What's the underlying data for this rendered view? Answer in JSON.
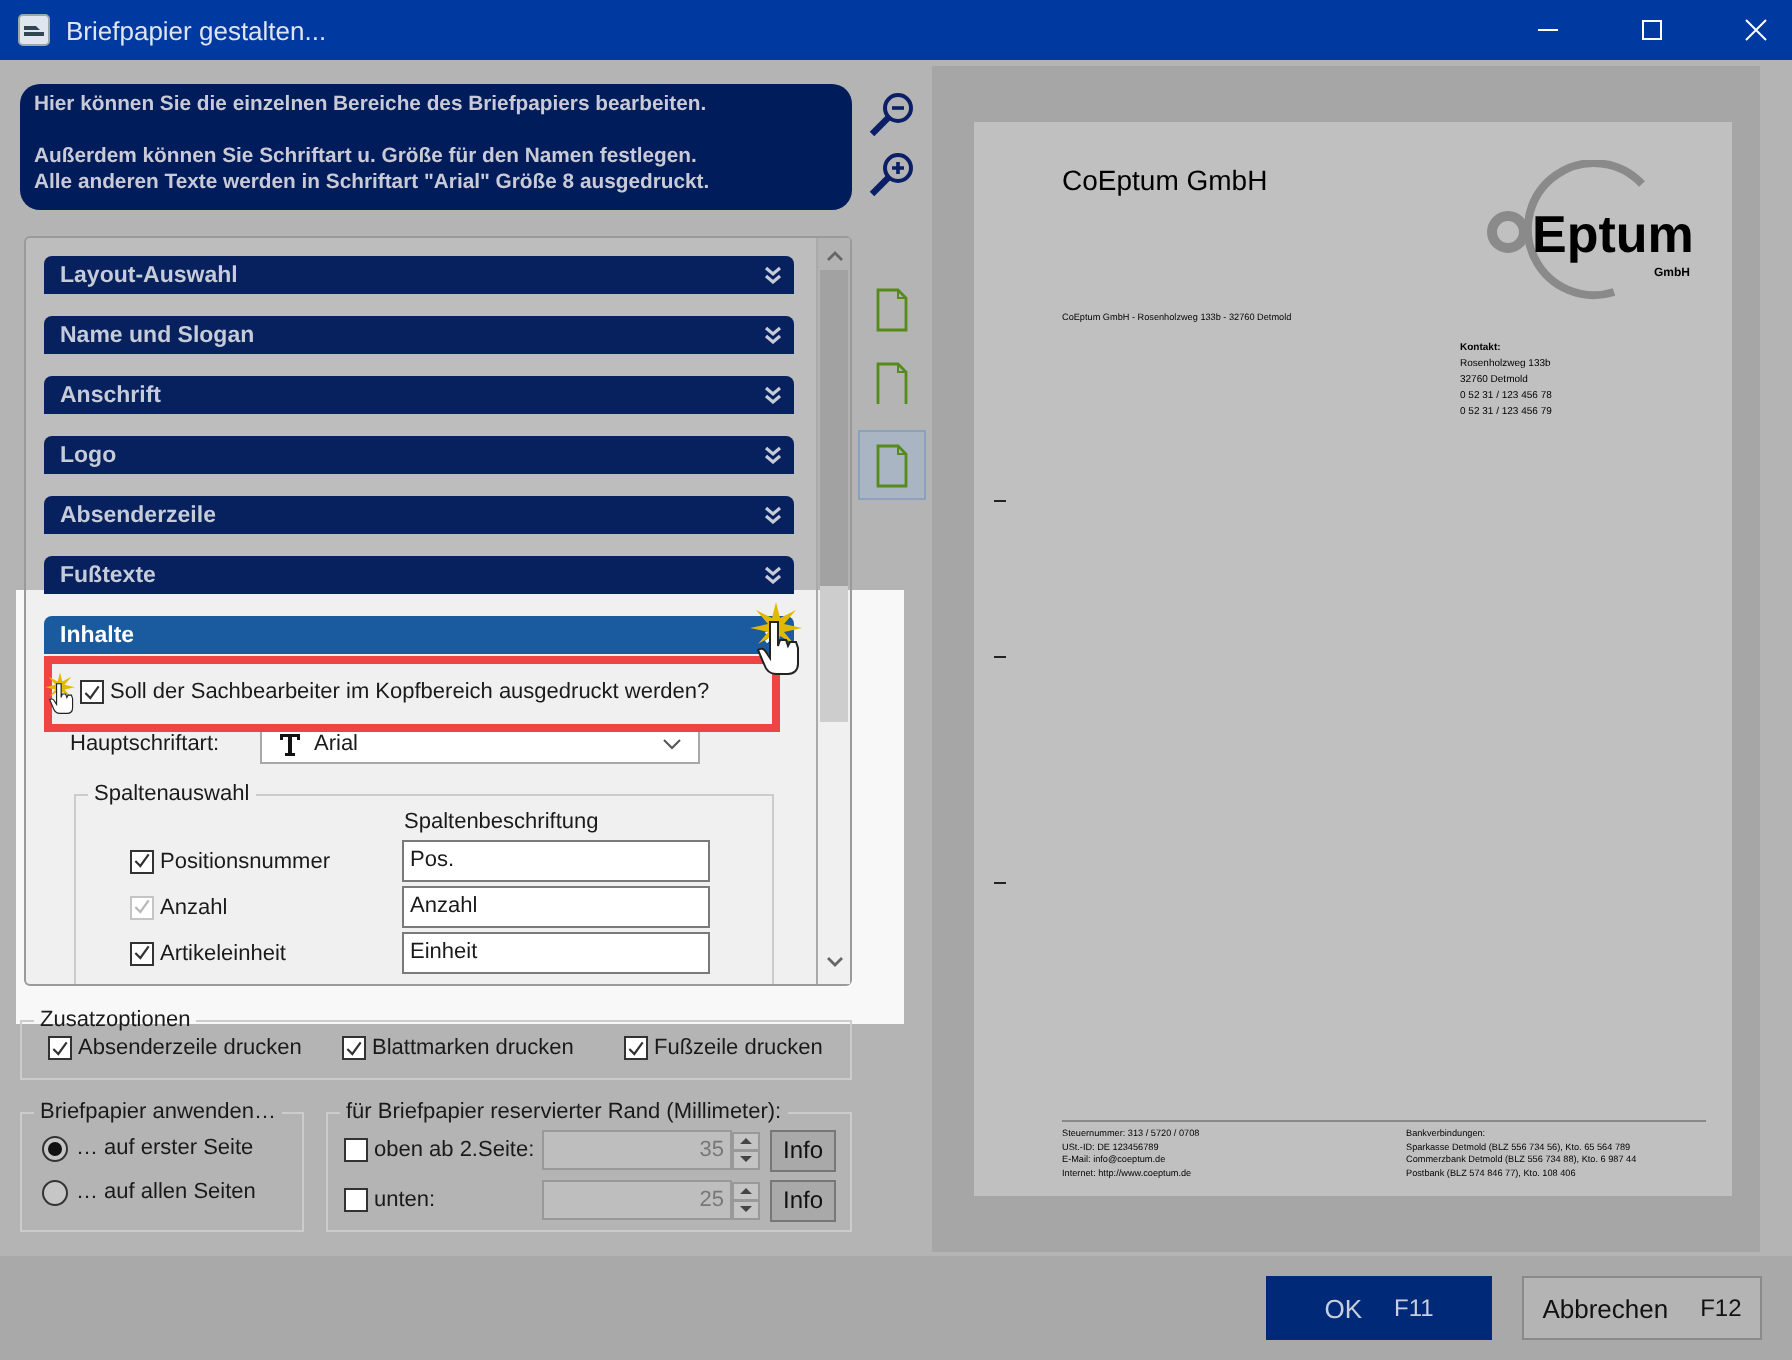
{
  "window": {
    "title": "Briefpapier gestalten..."
  },
  "info": {
    "paragraphs": [
      [
        "Hier können Sie die einzelnen Bereiche des Briefpapiers bearbeiten."
      ],
      [
        "Außerdem können Sie Schriftart u. Größe für den Namen festlegen.",
        "Alle anderen Texte werden in Schriftart \"Arial\" Größe 8 ausgedruckt."
      ]
    ]
  },
  "sections": [
    {
      "title": "Layout-Auswahl",
      "expanded": false
    },
    {
      "title": "Name und Slogan",
      "expanded": false
    },
    {
      "title": "Anschrift",
      "expanded": false
    },
    {
      "title": "Logo",
      "expanded": false
    },
    {
      "title": "Absenderzeile",
      "expanded": false
    },
    {
      "title": "Fußtexte",
      "expanded": false
    },
    {
      "title": "Inhalte",
      "expanded": true
    }
  ],
  "content": {
    "print_clerk": {
      "label": "Soll der Sachbearbeiter im Kopfbereich ausgedruckt werden?",
      "checked": true
    },
    "font": {
      "label": "Hauptschriftart:",
      "value": "Arial"
    },
    "columns_group": {
      "title": "Spaltenauswahl",
      "header": "Spaltenbeschriftung",
      "rows": [
        {
          "label": "Positionsnummer",
          "checked": true,
          "disabled": false,
          "value": "Pos."
        },
        {
          "label": "Anzahl",
          "checked": true,
          "disabled": true,
          "value": "Anzahl"
        },
        {
          "label": "Artikeleinheit",
          "checked": true,
          "disabled": false,
          "value": "Einheit"
        }
      ]
    }
  },
  "extra_options": {
    "title": "Zusatzoptionen",
    "items": [
      {
        "label": "Absenderzeile drucken",
        "checked": true
      },
      {
        "label": "Blattmarken drucken",
        "checked": true
      },
      {
        "label": "Fußzeile drucken",
        "checked": true
      }
    ]
  },
  "apply": {
    "title": "Briefpapier anwenden…",
    "options": [
      {
        "label": "… auf erster Seite",
        "selected": true
      },
      {
        "label": "… auf allen Seiten",
        "selected": false
      }
    ]
  },
  "margin": {
    "title": "für Briefpapier reservierter Rand (Millimeter):",
    "rows": [
      {
        "label": "oben ab 2.Seite:",
        "checked": false,
        "value": "35",
        "button": "Info"
      },
      {
        "label": "unten:",
        "checked": false,
        "value": "25",
        "button": "Info"
      }
    ]
  },
  "page_buttons": [
    {
      "selected": false
    },
    {
      "selected": false
    },
    {
      "selected": true
    }
  ],
  "preview": {
    "company": "CoEptum GmbH",
    "logo": {
      "mark": "Eptum",
      "sub": "GmbH"
    },
    "sender_line": "CoEptum GmbH - Rosenholzweg 133b - 32760 Detmold",
    "contact": {
      "title": "Kontakt:",
      "lines": [
        "Rosenholzweg 133b",
        "32760 Detmold",
        "0 52 31 / 123 456 78",
        "0 52 31 / 123 456 79"
      ]
    },
    "footer": {
      "left": [
        "Steuernummer: 313 / 5720 / 0708",
        "USt.-ID: DE 123456789",
        "E-Mail: info@coeptum.de",
        "Internet: http://www.coeptum.de"
      ],
      "right": [
        "Bankverbindungen:",
        "Sparkasse Detmold (BLZ 556 734 56), Kto. 65 564 789",
        "Commerzbank Detmold (BLZ 556 734 88), Kto. 6 987 44",
        "Postbank (BLZ 574 846 77), Kto. 108 406"
      ]
    }
  },
  "buttons": [
    {
      "label": "OK",
      "key": "F11",
      "kind": "primary"
    },
    {
      "label": "Abbrechen",
      "key": "F12",
      "kind": "secondary"
    }
  ]
}
